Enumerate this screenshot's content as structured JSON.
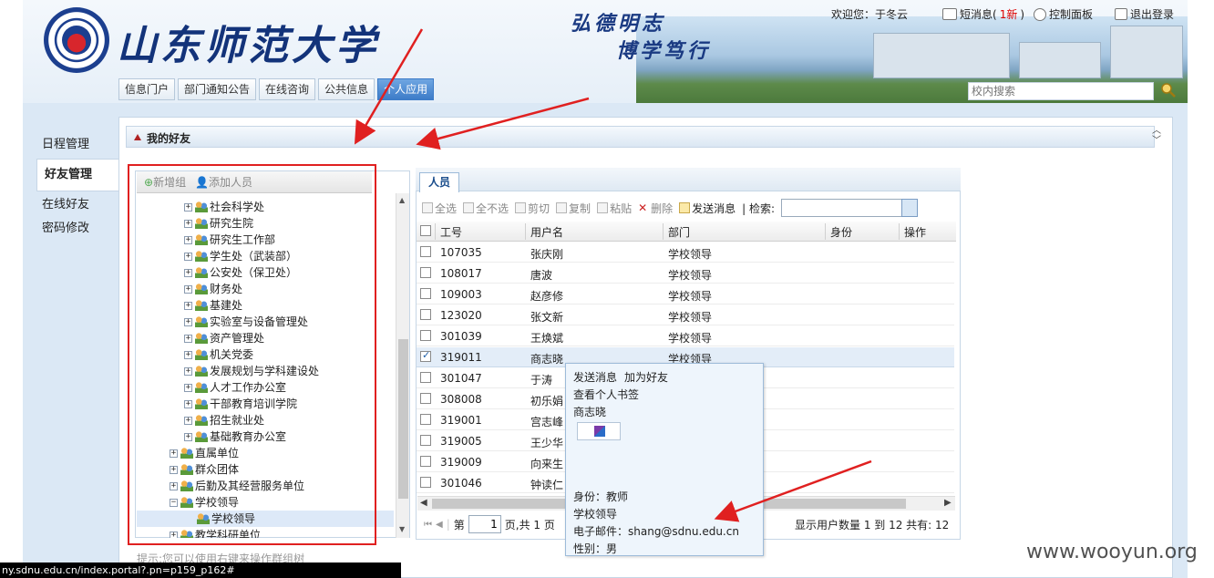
{
  "header": {
    "school_name": "山东师范大学",
    "motto_line1": "弘德明志",
    "motto_line2": "博学笃行",
    "welcome": "欢迎您：于冬云",
    "messages_label": "短消息(",
    "messages_count": "1新",
    "messages_close": ")",
    "control_panel": "控制面板",
    "logout": "退出登录",
    "search_placeholder": "校内搜索"
  },
  "tabs": [
    {
      "label": "信息门户"
    },
    {
      "label": "部门通知公告"
    },
    {
      "label": "在线咨询"
    },
    {
      "label": "公共信息"
    },
    {
      "label": "个人应用"
    }
  ],
  "left_nav": [
    {
      "label": "日程管理"
    },
    {
      "label": "好友管理"
    },
    {
      "label": "在线好友"
    },
    {
      "label": "密码修改"
    }
  ],
  "panel_title": "我的好友",
  "tree_toolbar": {
    "new_group": "新增组",
    "add_person": "添加人员"
  },
  "tree": [
    {
      "label": "社会科学处",
      "level": 2
    },
    {
      "label": "研究生院",
      "level": 2
    },
    {
      "label": "研究生工作部",
      "level": 2
    },
    {
      "label": "学生处（武装部）",
      "level": 2
    },
    {
      "label": "公安处（保卫处）",
      "level": 2
    },
    {
      "label": "财务处",
      "level": 2
    },
    {
      "label": "基建处",
      "level": 2
    },
    {
      "label": "实验室与设备管理处",
      "level": 2
    },
    {
      "label": "资产管理处",
      "level": 2
    },
    {
      "label": "机关党委",
      "level": 2
    },
    {
      "label": "发展规划与学科建设处",
      "level": 2
    },
    {
      "label": "人才工作办公室",
      "level": 2
    },
    {
      "label": "干部教育培训学院",
      "level": 2
    },
    {
      "label": "招生就业处",
      "level": 2
    },
    {
      "label": "基础教育办公室",
      "level": 2
    },
    {
      "label": "直属单位",
      "level": 1
    },
    {
      "label": "群众团体",
      "level": 1
    },
    {
      "label": "后勤及其经营服务单位",
      "level": 1
    },
    {
      "label": "学校领导",
      "level": 1
    },
    {
      "label": "学校领导",
      "level": 2
    },
    {
      "label": "教学科研单位",
      "level": 1
    }
  ],
  "grid": {
    "tab_label": "人员",
    "toolbar": {
      "select_all": "全选",
      "select_none": "全不选",
      "cut": "剪切",
      "copy": "复制",
      "paste": "粘贴",
      "delete": "删除",
      "send_message": "发送消息",
      "search_label": "| 检索:"
    },
    "columns": [
      "工号",
      "用户名",
      "部门",
      "身份",
      "操作"
    ],
    "rows": [
      {
        "id": "107035",
        "name": "张庆刚",
        "dept": "学校领导"
      },
      {
        "id": "108017",
        "name": "唐波",
        "dept": "学校领导"
      },
      {
        "id": "109003",
        "name": "赵彦修",
        "dept": "学校领导"
      },
      {
        "id": "123020",
        "name": "张文新",
        "dept": "学校领导"
      },
      {
        "id": "301039",
        "name": "王焕斌",
        "dept": "学校领导"
      },
      {
        "id": "319011",
        "name": "商志晓",
        "dept": "学校领导"
      },
      {
        "id": "301047",
        "name": "于涛",
        "dept": ""
      },
      {
        "id": "308008",
        "name": "初乐娟",
        "dept": ""
      },
      {
        "id": "319001",
        "name": "宫志峰",
        "dept": ""
      },
      {
        "id": "319005",
        "name": "王少华",
        "dept": ""
      },
      {
        "id": "319009",
        "name": "向来生",
        "dept": ""
      },
      {
        "id": "301046",
        "name": "钟读仁",
        "dept": ""
      }
    ],
    "pager": {
      "page_prefix": "第",
      "page_value": "1",
      "page_suffix": "页,共 1 页",
      "summary": "显示用户数量 1 到 12 共有: 12"
    }
  },
  "popup": {
    "send_message": "发送消息",
    "add_friend": "加为好友",
    "view_bookmarks": "查看个人书签",
    "name": "商志晓",
    "identity": "身份：教师",
    "department": "学校领导",
    "email": "电子邮件：shang@sdnu.edu.cn",
    "gender": "性别：男"
  },
  "tip": "提示:您可以使用右键来操作群组树",
  "status_url": "ny.sdnu.edu.cn/index.portal?.pn=p159_p162#",
  "watermark": "www.wooyun.org"
}
